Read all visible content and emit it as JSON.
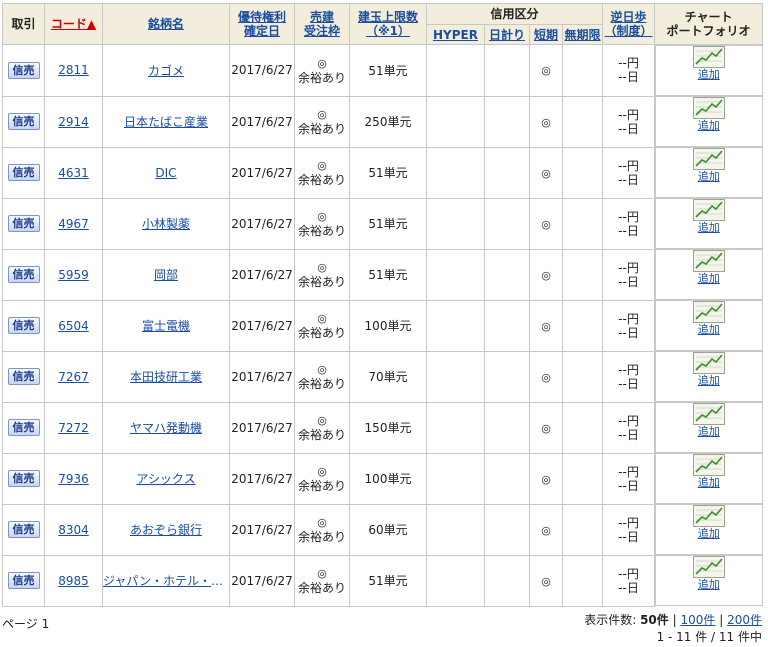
{
  "headers": {
    "trade": "取引",
    "code": "コード▲",
    "name": "銘柄名",
    "date": [
      "優待権利",
      "確定日"
    ],
    "order": [
      "売建",
      "受注枠"
    ],
    "limit": [
      "建玉上限数",
      "（※1）"
    ],
    "credit": "信用区分",
    "hyper": "HYPER",
    "daily": "日計り",
    "short": "短期",
    "indef": "無期限",
    "reverse": [
      "逆日歩",
      "（制度）"
    ],
    "chart": [
      "チャート",
      "ポートフォリオ"
    ]
  },
  "trade_button": "信売",
  "add_label": "追加",
  "rows": [
    {
      "code": "2811",
      "name": "カゴメ",
      "date": "2017/6/27",
      "order_mark": "◎",
      "order_text": "余裕あり",
      "limit": "51単元",
      "short": "◎",
      "rev_yen": "--円",
      "rev_day": "--日"
    },
    {
      "code": "2914",
      "name": "日本たばこ産業",
      "date": "2017/6/27",
      "order_mark": "◎",
      "order_text": "余裕あり",
      "limit": "250単元",
      "short": "◎",
      "rev_yen": "--円",
      "rev_day": "--日"
    },
    {
      "code": "4631",
      "name": "DIC",
      "date": "2017/6/27",
      "order_mark": "◎",
      "order_text": "余裕あり",
      "limit": "51単元",
      "short": "◎",
      "rev_yen": "--円",
      "rev_day": "--日"
    },
    {
      "code": "4967",
      "name": "小林製薬",
      "date": "2017/6/27",
      "order_mark": "◎",
      "order_text": "余裕あり",
      "limit": "51単元",
      "short": "◎",
      "rev_yen": "--円",
      "rev_day": "--日"
    },
    {
      "code": "5959",
      "name": "岡部",
      "date": "2017/6/27",
      "order_mark": "◎",
      "order_text": "余裕あり",
      "limit": "51単元",
      "short": "◎",
      "rev_yen": "--円",
      "rev_day": "--日"
    },
    {
      "code": "6504",
      "name": "富士電機",
      "date": "2017/6/27",
      "order_mark": "◎",
      "order_text": "余裕あり",
      "limit": "100単元",
      "short": "◎",
      "rev_yen": "--円",
      "rev_day": "--日"
    },
    {
      "code": "7267",
      "name": "本田技研工業",
      "date": "2017/6/27",
      "order_mark": "◎",
      "order_text": "余裕あり",
      "limit": "70単元",
      "short": "◎",
      "rev_yen": "--円",
      "rev_day": "--日"
    },
    {
      "code": "7272",
      "name": "ヤマハ発動機",
      "date": "2017/6/27",
      "order_mark": "◎",
      "order_text": "余裕あり",
      "limit": "150単元",
      "short": "◎",
      "rev_yen": "--円",
      "rev_day": "--日"
    },
    {
      "code": "7936",
      "name": "アシックス",
      "date": "2017/6/27",
      "order_mark": "◎",
      "order_text": "余裕あり",
      "limit": "100単元",
      "short": "◎",
      "rev_yen": "--円",
      "rev_day": "--日"
    },
    {
      "code": "8304",
      "name": "あおぞら銀行",
      "date": "2017/6/27",
      "order_mark": "◎",
      "order_text": "余裕あり",
      "limit": "60単元",
      "short": "◎",
      "rev_yen": "--円",
      "rev_day": "--日"
    },
    {
      "code": "8985",
      "name": "ジャパン・ホテル・リ…",
      "date": "2017/6/27",
      "order_mark": "◎",
      "order_text": "余裕あり",
      "limit": "51単元",
      "short": "◎",
      "rev_yen": "--円",
      "rev_day": "--日"
    }
  ],
  "footer": {
    "page": "ページ 1",
    "display_label": "表示件数:",
    "opt50": "50件",
    "opt100": "100件",
    "opt200": "200件",
    "sep": "|",
    "range": "1 - 11 件 / 11 件中"
  },
  "colors": {
    "header_bg": "#f3eedb",
    "link": "#1a4ea3",
    "sorted": "#d40000",
    "border": "#c8c8c8"
  },
  "icons": {
    "chart": "line-chart-icon"
  }
}
